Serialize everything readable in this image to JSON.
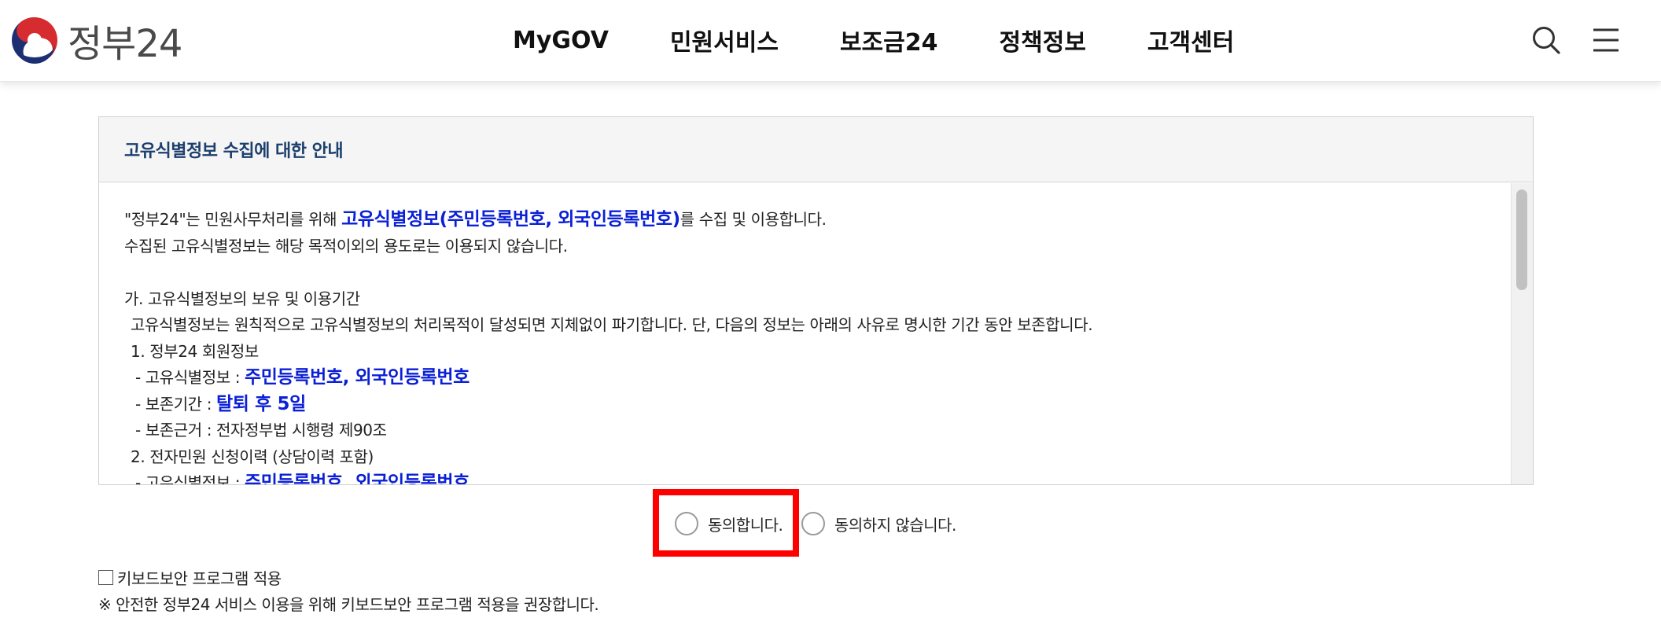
{
  "header": {
    "logo_text": "정부24",
    "nav": [
      "MyGOV",
      "민원서비스",
      "보조금24",
      "정책정보",
      "고객센터"
    ],
    "icons": [
      "search-icon",
      "hamburger-menu-icon"
    ]
  },
  "terms": {
    "title": "고유식별정보 수집에 대한 안내",
    "intro1_a": "\"정부24\"는 민원사무처리를 위해 ",
    "intro1_hl": "고유식별정보(주민등록번호, 외국인등록번호)",
    "intro1_b": "를 수집 및 이용합니다.",
    "intro2": "수집된 고유식별정보는 해당 목적이외의 용도로는 이용되지 않습니다.",
    "section_a": "가. 고유식별정보의 보유 및 이용기간",
    "section_a_desc": "고유식별정보는 원칙적으로 고유식별정보의 처리목적이 달성되면 지체없이 파기합니다. 단, 다음의 정보는 아래의 사유로 명시한 기간 동안 보존합니다.",
    "item1": "1. 정부24 회원정보",
    "item1_id_label": "- 고유식별정보 : ",
    "item1_id_value": "주민등록번호, 외국인등록번호",
    "item1_period_label": "- 보존기간 : ",
    "item1_period_value": "탈퇴 후 5일",
    "item1_basis": "- 보존근거 : 전자정부법 시행령 제90조",
    "item2": "2. 전자민원 신청이력 (상담이력 포함)",
    "item2_id_label": "- 고유식별정보 : ",
    "item2_id_value": "주민등록번호, 외국인등록번호"
  },
  "consent": {
    "agree": "동의합니다.",
    "disagree": "동의하지 않습니다.",
    "highlight_color": "#ff0000"
  },
  "keyboard": {
    "label": "키보드보안 프로그램 적용",
    "note": "※ 안전한 정부24 서비스 이용을 위해 키보드보안 프로그램 적용을 권장합니다."
  },
  "colors": {
    "highlight_text": "#0a1fd6",
    "title": "#1c3f6e"
  }
}
